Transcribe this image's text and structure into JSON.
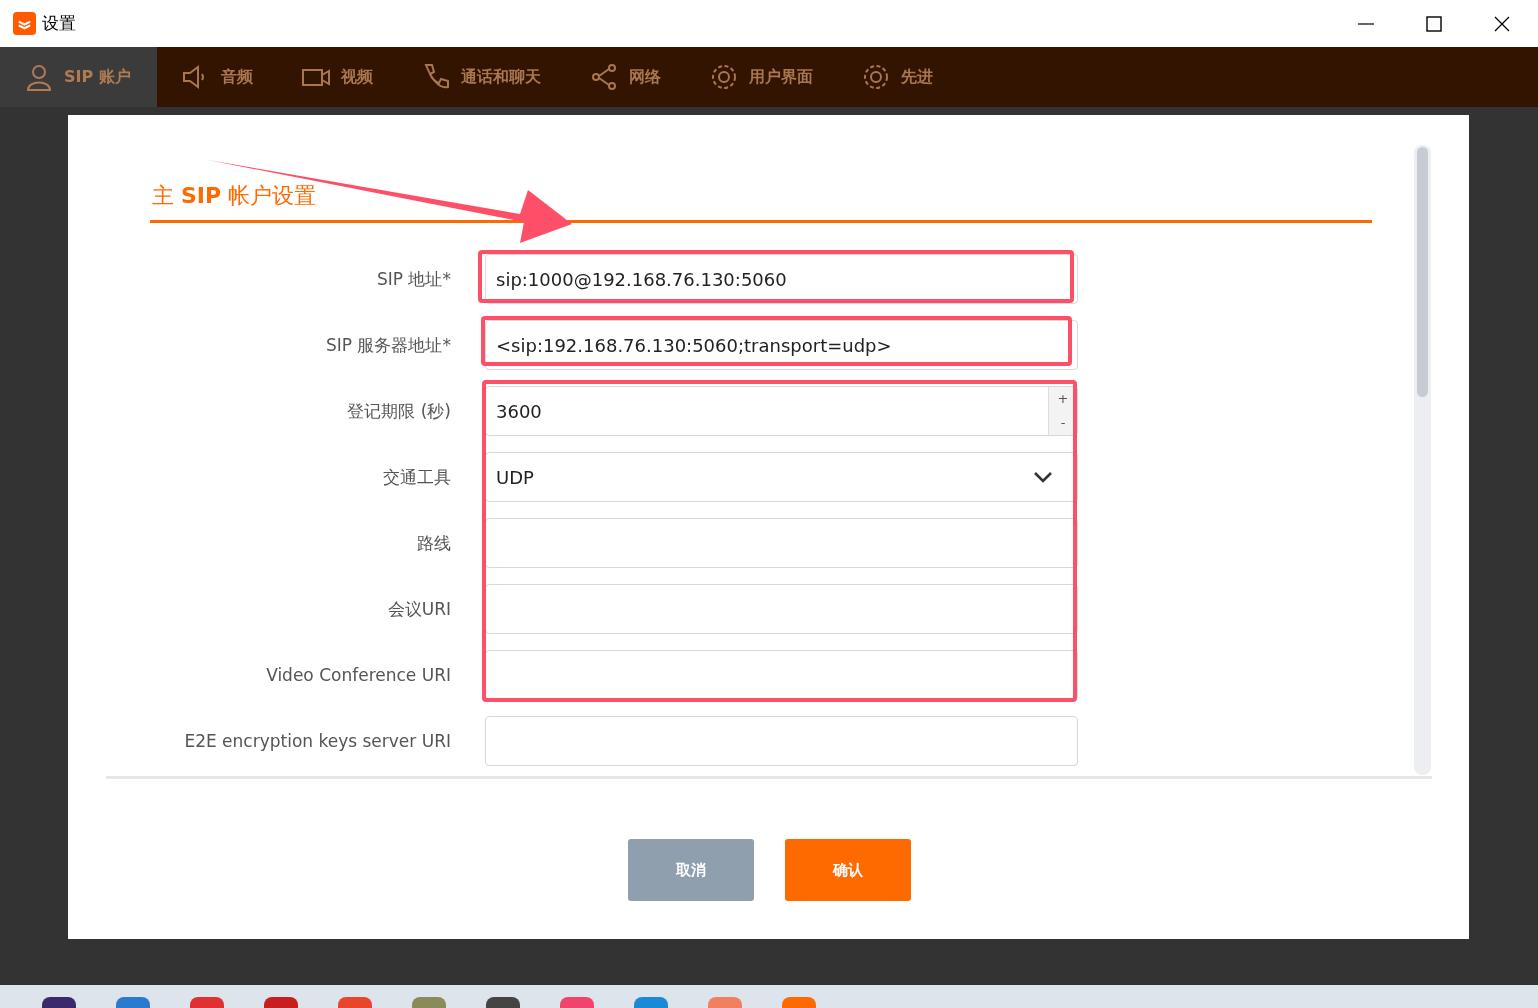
{
  "window": {
    "title": "设置"
  },
  "tabs": [
    {
      "label": "SIP 账户",
      "kind": "user",
      "selected": true
    },
    {
      "label": "音频",
      "kind": "speaker",
      "selected": false
    },
    {
      "label": "视频",
      "kind": "camera",
      "selected": false
    },
    {
      "label": "通话和聊天",
      "kind": "phone",
      "selected": false
    },
    {
      "label": "网络",
      "kind": "share",
      "selected": false
    },
    {
      "label": "用户界面",
      "kind": "gear",
      "selected": false
    },
    {
      "label": "先进",
      "kind": "gear",
      "selected": false
    }
  ],
  "dialog": {
    "heading": "主 **SIP** 帐户设置",
    "fields": [
      {
        "label": "SIP 地址*",
        "kind": "text",
        "value": "sip:1000@192.168.76.130:5060"
      },
      {
        "label": "SIP 服务器地址*",
        "kind": "text",
        "value": "<sip:192.168.76.130:5060;transport=udp>"
      },
      {
        "label": "登记期限 (秒)",
        "kind": "number",
        "value": "3600",
        "spin_up": "+",
        "spin_down": "-"
      },
      {
        "label": "交通工具",
        "kind": "select",
        "value": "UDP"
      },
      {
        "label": "路线",
        "kind": "text"
      },
      {
        "label": "会议URI",
        "kind": "text"
      },
      {
        "label": "Video Conference URI",
        "kind": "text"
      },
      {
        "label": "E2E encryption keys server URI",
        "kind": "text"
      }
    ],
    "buttons": [
      {
        "label": "取消",
        "kind": "secondary"
      },
      {
        "label": "确认",
        "kind": "primary"
      }
    ]
  }
}
